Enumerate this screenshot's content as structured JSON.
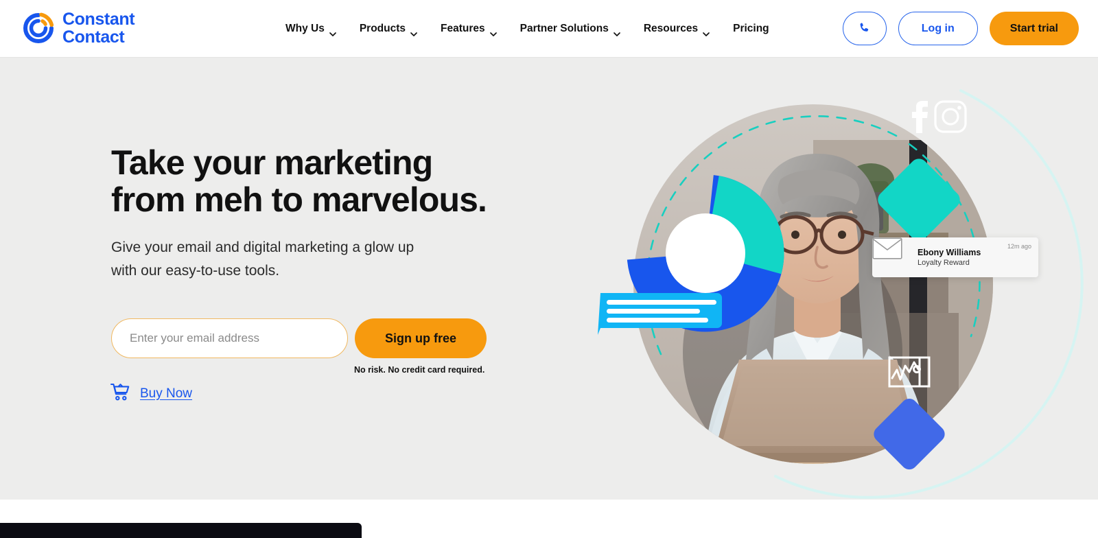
{
  "brand": {
    "name_line1": "Constant",
    "name_line2": "Contact",
    "logo_icon": "constant-contact-logo-icon",
    "blue": "#1856ed",
    "orange": "#f79a0e",
    "teal": "#12d6c6",
    "cyan": "#10b5f5",
    "indigo": "#4169e8"
  },
  "nav": {
    "items": [
      {
        "label": "Why Us",
        "has_dropdown": true
      },
      {
        "label": "Products",
        "has_dropdown": true
      },
      {
        "label": "Features",
        "has_dropdown": true
      },
      {
        "label": "Partner Solutions",
        "has_dropdown": true
      },
      {
        "label": "Resources",
        "has_dropdown": true
      },
      {
        "label": "Pricing",
        "has_dropdown": false
      }
    ]
  },
  "header_actions": {
    "phone_icon": "phone-icon",
    "login_label": "Log in",
    "trial_label": "Start trial"
  },
  "hero": {
    "title": "Take your marketing\nfrom meh to marvelous.",
    "subtitle": "Give your email and digital marketing a glow up\nwith our easy-to-use tools.",
    "email_placeholder": "Enter your email address",
    "email_value": "",
    "signup_label": "Sign up free",
    "disclaimer": "No risk. No credit card required.",
    "buy_now_label": "Buy Now",
    "buy_now_icon": "shopping-cart-icon",
    "background_color": "#ededec"
  },
  "art": {
    "photo_alt": "woman-with-laptop-photo",
    "donut": {
      "name": "donut-chart",
      "segments": [
        {
          "label": "blue",
          "color": "#1856ed",
          "percent": 72
        },
        {
          "label": "teal",
          "color": "#12d6c6",
          "percent": 28
        }
      ]
    },
    "message_bubble": {
      "name": "message-bubble-icon",
      "color": "#10b5f5",
      "lines": 3
    },
    "social_tile": {
      "name": "social-tile",
      "color": "#12d6c6",
      "icons": [
        "facebook-icon",
        "instagram-icon"
      ]
    },
    "analytics_tile": {
      "name": "analytics-tile",
      "color": "#4169e8",
      "icon": "line-chart-icon"
    },
    "dashed_arc_color": "#18cfc0",
    "solid_arc_color": "#d6f4f2"
  },
  "notification": {
    "icon": "envelope-icon",
    "name": "Ebony Williams",
    "subtitle": "Loyalty Reward",
    "time": "12m ago"
  },
  "bottom_widget": {
    "name": "bottom-widget-bar",
    "color": "#0b0b12"
  }
}
